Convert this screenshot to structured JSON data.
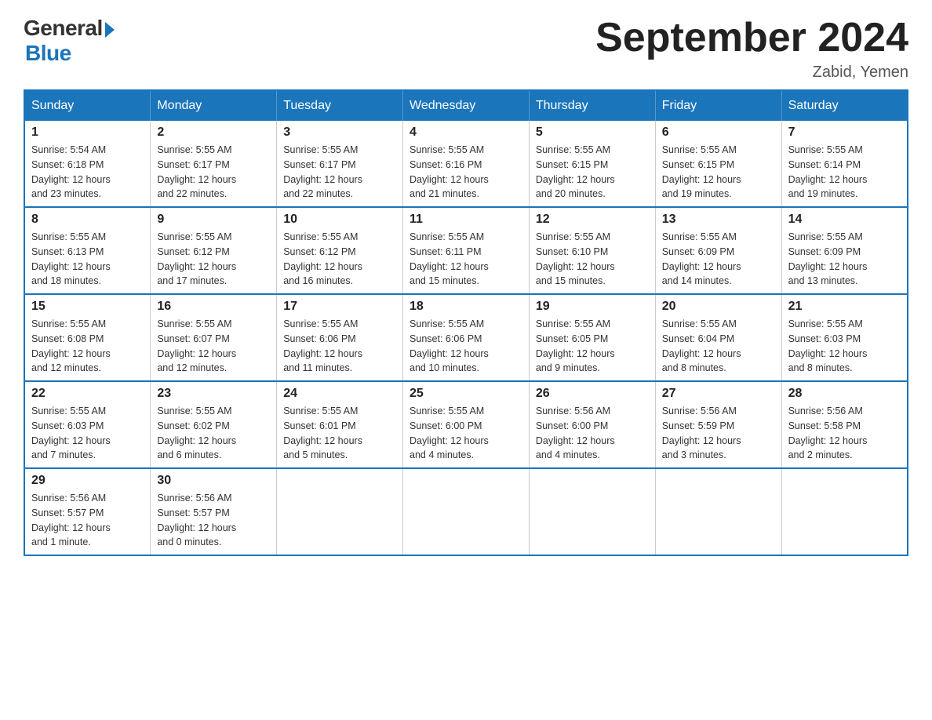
{
  "logo": {
    "general": "General",
    "blue": "Blue"
  },
  "title": {
    "month_year": "September 2024",
    "location": "Zabid, Yemen"
  },
  "weekdays": [
    "Sunday",
    "Monday",
    "Tuesday",
    "Wednesday",
    "Thursday",
    "Friday",
    "Saturday"
  ],
  "weeks": [
    [
      {
        "day": "1",
        "sunrise": "5:54 AM",
        "sunset": "6:18 PM",
        "daylight": "12 hours and 23 minutes."
      },
      {
        "day": "2",
        "sunrise": "5:55 AM",
        "sunset": "6:17 PM",
        "daylight": "12 hours and 22 minutes."
      },
      {
        "day": "3",
        "sunrise": "5:55 AM",
        "sunset": "6:17 PM",
        "daylight": "12 hours and 22 minutes."
      },
      {
        "day": "4",
        "sunrise": "5:55 AM",
        "sunset": "6:16 PM",
        "daylight": "12 hours and 21 minutes."
      },
      {
        "day": "5",
        "sunrise": "5:55 AM",
        "sunset": "6:15 PM",
        "daylight": "12 hours and 20 minutes."
      },
      {
        "day": "6",
        "sunrise": "5:55 AM",
        "sunset": "6:15 PM",
        "daylight": "12 hours and 19 minutes."
      },
      {
        "day": "7",
        "sunrise": "5:55 AM",
        "sunset": "6:14 PM",
        "daylight": "12 hours and 19 minutes."
      }
    ],
    [
      {
        "day": "8",
        "sunrise": "5:55 AM",
        "sunset": "6:13 PM",
        "daylight": "12 hours and 18 minutes."
      },
      {
        "day": "9",
        "sunrise": "5:55 AM",
        "sunset": "6:12 PM",
        "daylight": "12 hours and 17 minutes."
      },
      {
        "day": "10",
        "sunrise": "5:55 AM",
        "sunset": "6:12 PM",
        "daylight": "12 hours and 16 minutes."
      },
      {
        "day": "11",
        "sunrise": "5:55 AM",
        "sunset": "6:11 PM",
        "daylight": "12 hours and 15 minutes."
      },
      {
        "day": "12",
        "sunrise": "5:55 AM",
        "sunset": "6:10 PM",
        "daylight": "12 hours and 15 minutes."
      },
      {
        "day": "13",
        "sunrise": "5:55 AM",
        "sunset": "6:09 PM",
        "daylight": "12 hours and 14 minutes."
      },
      {
        "day": "14",
        "sunrise": "5:55 AM",
        "sunset": "6:09 PM",
        "daylight": "12 hours and 13 minutes."
      }
    ],
    [
      {
        "day": "15",
        "sunrise": "5:55 AM",
        "sunset": "6:08 PM",
        "daylight": "12 hours and 12 minutes."
      },
      {
        "day": "16",
        "sunrise": "5:55 AM",
        "sunset": "6:07 PM",
        "daylight": "12 hours and 12 minutes."
      },
      {
        "day": "17",
        "sunrise": "5:55 AM",
        "sunset": "6:06 PM",
        "daylight": "12 hours and 11 minutes."
      },
      {
        "day": "18",
        "sunrise": "5:55 AM",
        "sunset": "6:06 PM",
        "daylight": "12 hours and 10 minutes."
      },
      {
        "day": "19",
        "sunrise": "5:55 AM",
        "sunset": "6:05 PM",
        "daylight": "12 hours and 9 minutes."
      },
      {
        "day": "20",
        "sunrise": "5:55 AM",
        "sunset": "6:04 PM",
        "daylight": "12 hours and 8 minutes."
      },
      {
        "day": "21",
        "sunrise": "5:55 AM",
        "sunset": "6:03 PM",
        "daylight": "12 hours and 8 minutes."
      }
    ],
    [
      {
        "day": "22",
        "sunrise": "5:55 AM",
        "sunset": "6:03 PM",
        "daylight": "12 hours and 7 minutes."
      },
      {
        "day": "23",
        "sunrise": "5:55 AM",
        "sunset": "6:02 PM",
        "daylight": "12 hours and 6 minutes."
      },
      {
        "day": "24",
        "sunrise": "5:55 AM",
        "sunset": "6:01 PM",
        "daylight": "12 hours and 5 minutes."
      },
      {
        "day": "25",
        "sunrise": "5:55 AM",
        "sunset": "6:00 PM",
        "daylight": "12 hours and 4 minutes."
      },
      {
        "day": "26",
        "sunrise": "5:56 AM",
        "sunset": "6:00 PM",
        "daylight": "12 hours and 4 minutes."
      },
      {
        "day": "27",
        "sunrise": "5:56 AM",
        "sunset": "5:59 PM",
        "daylight": "12 hours and 3 minutes."
      },
      {
        "day": "28",
        "sunrise": "5:56 AM",
        "sunset": "5:58 PM",
        "daylight": "12 hours and 2 minutes."
      }
    ],
    [
      {
        "day": "29",
        "sunrise": "5:56 AM",
        "sunset": "5:57 PM",
        "daylight": "12 hours and 1 minute."
      },
      {
        "day": "30",
        "sunrise": "5:56 AM",
        "sunset": "5:57 PM",
        "daylight": "12 hours and 0 minutes."
      },
      null,
      null,
      null,
      null,
      null
    ]
  ],
  "labels": {
    "sunrise": "Sunrise:",
    "sunset": "Sunset:",
    "daylight": "Daylight:"
  }
}
